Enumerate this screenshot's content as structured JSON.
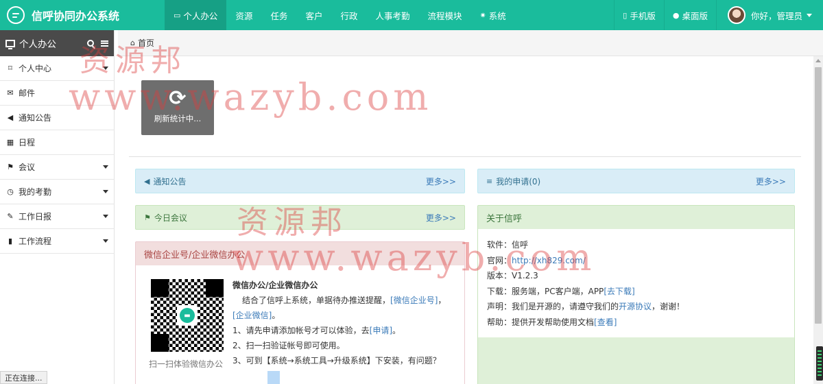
{
  "app": {
    "title": "信呼协同办公系统"
  },
  "nav": {
    "items": [
      {
        "icon": "monitor-icon",
        "label": "个人办公",
        "active": true
      },
      {
        "label": "资源"
      },
      {
        "label": "任务"
      },
      {
        "label": "客户"
      },
      {
        "label": "行政"
      },
      {
        "label": "人事考勤"
      },
      {
        "label": "流程模块"
      },
      {
        "icon": "gear-icon",
        "label": "系统"
      }
    ],
    "right": [
      {
        "icon": "mobile-icon",
        "label": "手机版"
      },
      {
        "icon": "globe-icon",
        "label": "桌面版"
      }
    ],
    "user": {
      "greeting": "你好，管理员"
    }
  },
  "sidebar": {
    "title": "个人办公",
    "items": [
      {
        "icon": "bookmark-icon",
        "label": "个人中心",
        "caret": true
      },
      {
        "icon": "envelope-icon",
        "label": "邮件",
        "caret": false
      },
      {
        "icon": "volume-icon",
        "label": "通知公告",
        "caret": false
      },
      {
        "icon": "calendar-icon",
        "label": "日程",
        "caret": false
      },
      {
        "icon": "flag-icon",
        "label": "会议",
        "caret": true
      },
      {
        "icon": "clock-icon",
        "label": "我的考勤",
        "caret": true
      },
      {
        "icon": "edit-icon",
        "label": "工作日报",
        "caret": true
      },
      {
        "icon": "book-icon",
        "label": "工作流程",
        "caret": true
      }
    ]
  },
  "breadcrumb": {
    "home": "首页"
  },
  "loading": {
    "text": "刷新统计中..."
  },
  "panels": {
    "notice": {
      "title": "通知公告",
      "more": "更多>>"
    },
    "my_apply": {
      "title": "我的申请(0)",
      "more": "更多>>"
    },
    "meeting": {
      "title": "今日会议",
      "more": "更多>>"
    },
    "wechat": {
      "title": "微信企业号/企业微信办公",
      "qr_caption": "扫一扫体验微信办公",
      "heading": "微信办公/企业微信办公",
      "line1_a": "结合了信呼上系统，单据待办推送提醒，",
      "link1": "[微信企业号]",
      "line1_b": "，",
      "link2": "[企业微信]",
      "line1_c": "。",
      "line2_a": "1、请先申请添加帐号才可以体验，去",
      "link3": "[申请]",
      "line2_b": "。",
      "line3": "2、扫一扫验证帐号即可使用。",
      "line4": "3、可到【系统→系统工具→升级系统】下安装，有问题？"
    },
    "about": {
      "title": "关于信呼",
      "software": "软件：信呼",
      "site_label": "官网：",
      "site_link": "http://xh829.com/",
      "version": "版本：V1.2.3",
      "download_label": "下载：服务端，PC客户端，APP",
      "download_link": "[去下载]",
      "statement_label": "声明：我们是开源的，请遵守我们的",
      "statement_link": "开源协议",
      "statement_tail": "，谢谢！",
      "help_label": "帮助：提供开发帮助使用文档",
      "help_link": "[查看]"
    }
  },
  "statusbar": {
    "text": "正在连接..."
  },
  "watermark": {
    "cn": "资源邦",
    "url": "www.wazyb.com"
  }
}
